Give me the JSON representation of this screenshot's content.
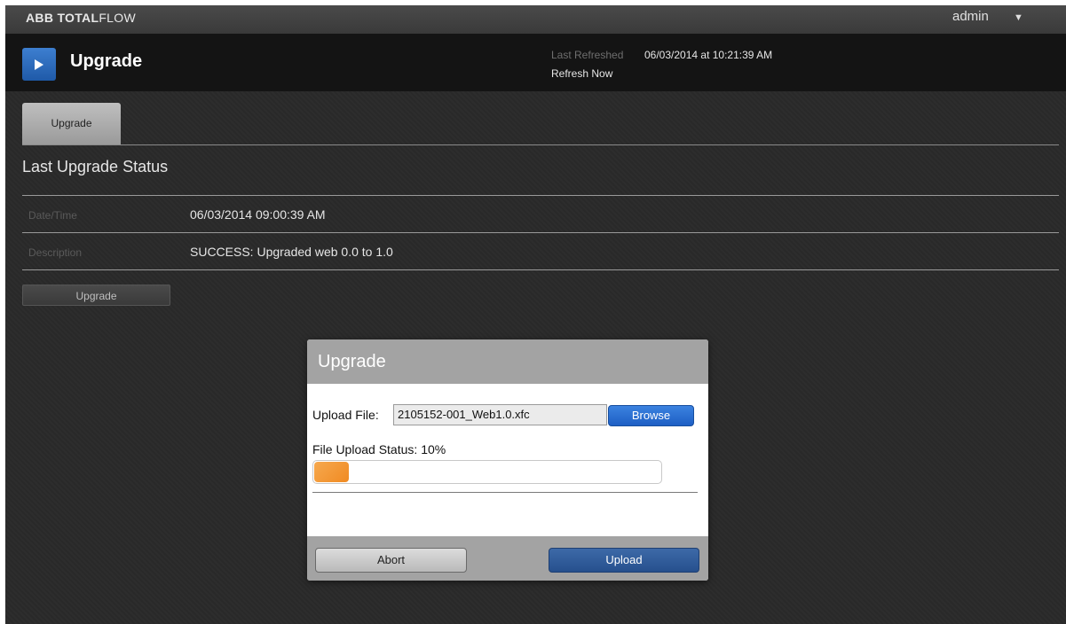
{
  "brand": {
    "bold": "ABB",
    "total": "TOTAL",
    "flow": "FLOW"
  },
  "user": {
    "name": "admin",
    "caret_icon": "caret-down-icon"
  },
  "header": {
    "play_icon": "play-icon",
    "title": "Upgrade",
    "last_refreshed_label": "Last Refreshed",
    "last_refreshed_value": "06/03/2014 at 10:21:39 AM",
    "refresh_now": "Refresh Now"
  },
  "tabs": [
    {
      "label": "Upgrade",
      "active": true
    }
  ],
  "status": {
    "title": "Last Upgrade Status",
    "rows": [
      {
        "label": "Date/Time",
        "value": "06/03/2014 09:00:39 AM"
      },
      {
        "label": "Description",
        "value": "SUCCESS: Upgraded web 0.0 to 1.0"
      }
    ]
  },
  "page_upgrade_button": "Upgrade",
  "dialog": {
    "title": "Upgrade",
    "upload_file_label": "Upload File:",
    "file_value": "2105152-001_Web1.0.xfc",
    "browse_label": "Browse",
    "status_label": "File Upload Status:",
    "status_percent": "10%",
    "progress": 0.1,
    "abort_label": "Abort",
    "upload_label": "Upload"
  },
  "colors": {
    "accent_blue": "#1f5aa8",
    "progress_orange": "#f08a22",
    "background": "#262626"
  }
}
